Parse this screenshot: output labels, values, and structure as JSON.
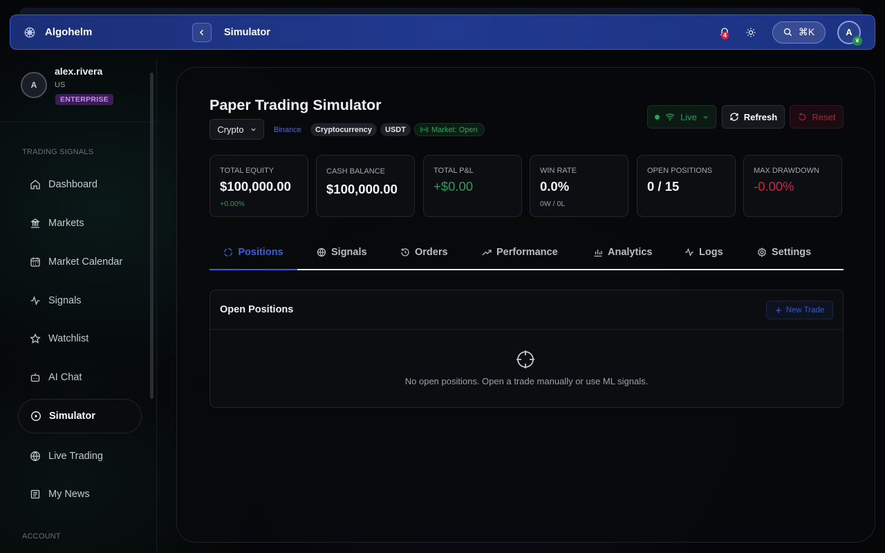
{
  "app": {
    "name": "Algohelm",
    "page_title": "Simulator",
    "notification_count": "4",
    "search_shortcut": "⌘K",
    "avatar_initial": "A"
  },
  "user": {
    "initial": "A",
    "name": "alex.rivera",
    "country": "US",
    "plan": "ENTERPRISE"
  },
  "sidebar": {
    "section_trading": "TRADING SIGNALS",
    "section_account": "ACCOUNT",
    "items": [
      {
        "label": "Dashboard",
        "icon": "home-icon"
      },
      {
        "label": "Markets",
        "icon": "building-icon"
      },
      {
        "label": "Market Calendar",
        "icon": "calendar-icon"
      },
      {
        "label": "Signals",
        "icon": "activity-icon"
      },
      {
        "label": "Watchlist",
        "icon": "star-icon"
      },
      {
        "label": "AI Chat",
        "icon": "bot-icon"
      },
      {
        "label": "Simulator",
        "icon": "play-circle-icon",
        "active": true
      },
      {
        "label": "Live Trading",
        "icon": "globe-icon"
      },
      {
        "label": "My News",
        "icon": "newspaper-icon"
      }
    ]
  },
  "header": {
    "title": "Paper Trading Simulator",
    "asset_select": "Crypto",
    "exchange": "Binance",
    "category": "Cryptocurrency",
    "currency": "USDT",
    "market_status": "Market: Open",
    "live_label": "Live",
    "refresh_label": "Refresh",
    "reset_label": "Reset"
  },
  "stats": [
    {
      "label": "TOTAL EQUITY",
      "value": "$100,000.00",
      "sub": "+0.00%"
    },
    {
      "label": "CASH BALANCE",
      "value": "$100,000.00",
      "sub": ""
    },
    {
      "label": "TOTAL P&L",
      "value": "+$0.00",
      "sub": ""
    },
    {
      "label": "WIN RATE",
      "value": "0.0%",
      "sub": "0W / 0L"
    },
    {
      "label": "OPEN POSITIONS",
      "value": "0 / 15",
      "sub": ""
    },
    {
      "label": "MAX DRAWDOWN",
      "value": "-0.00%",
      "sub": ""
    }
  ],
  "tabs": [
    {
      "label": "Positions",
      "active": true
    },
    {
      "label": "Signals"
    },
    {
      "label": "Orders"
    },
    {
      "label": "Performance"
    },
    {
      "label": "Analytics"
    },
    {
      "label": "Logs"
    },
    {
      "label": "Settings"
    }
  ],
  "positions": {
    "title": "Open Positions",
    "new_trade_label": "New Trade",
    "empty_text": "No open positions. Open a trade manually or use ML signals."
  },
  "colors": {
    "accent": "#3a5fd8",
    "positive": "#2a9e58",
    "negative": "#d2234a",
    "topbar": "#21398e"
  }
}
